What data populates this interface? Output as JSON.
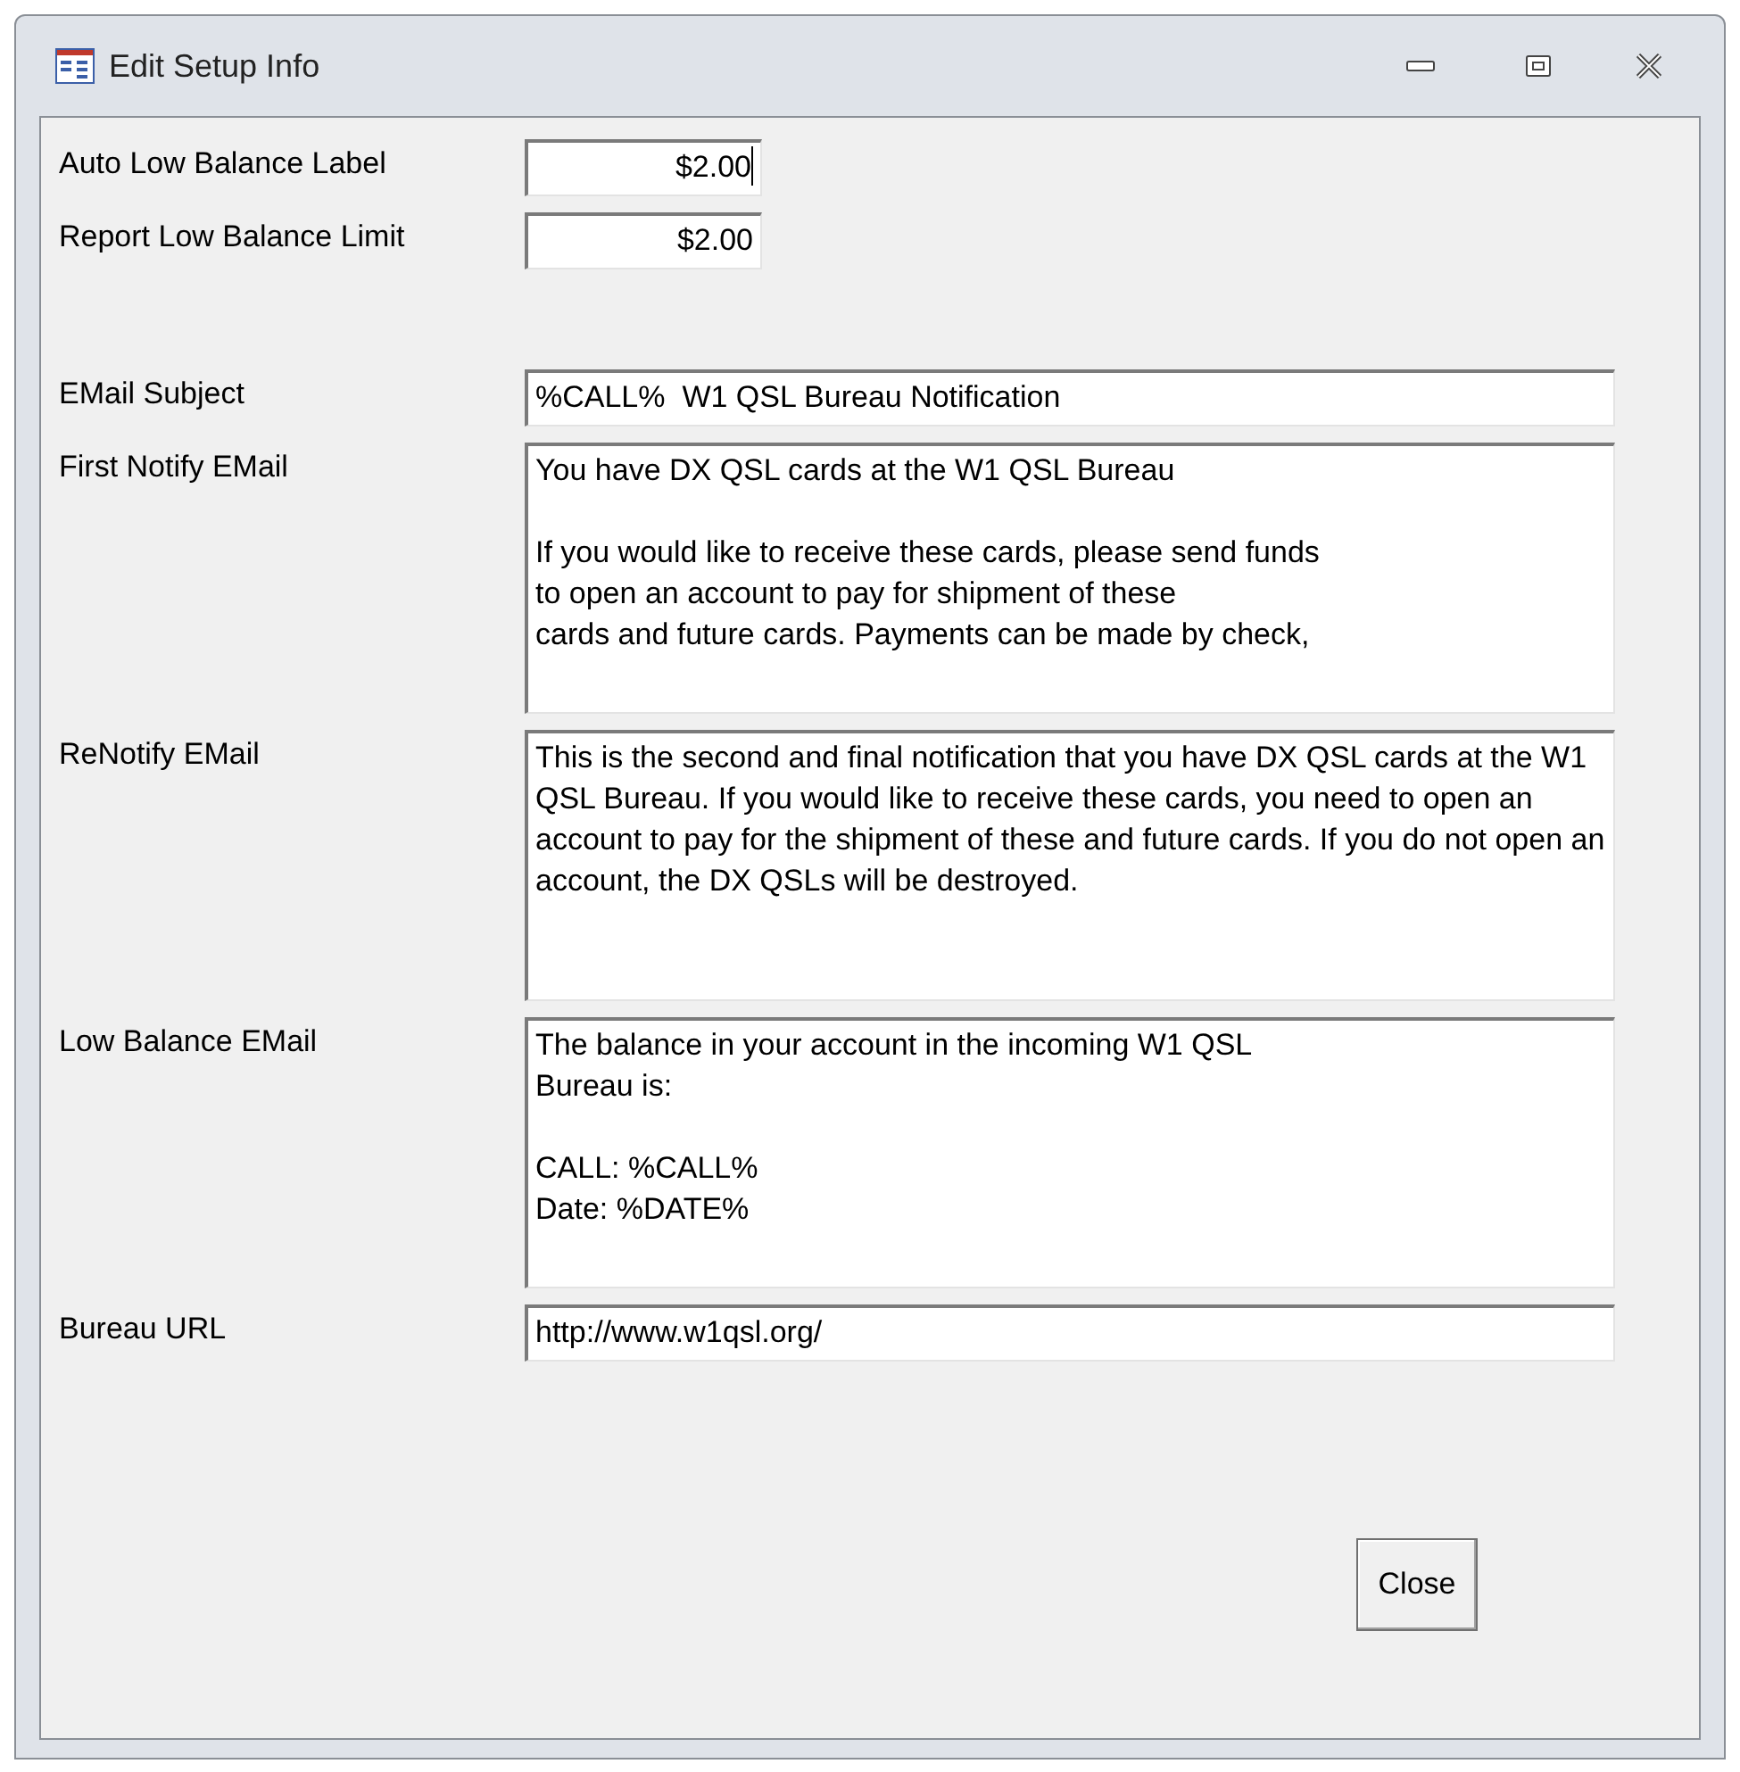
{
  "window": {
    "title": "Edit Setup Info"
  },
  "fields": [
    {
      "kind": "amount",
      "label": "Auto Low Balance Label",
      "value": "$2.00",
      "focused": true
    },
    {
      "kind": "amount",
      "label": "Report Low Balance Limit",
      "value": "$2.00",
      "focused": false
    },
    {
      "kind": "spacer"
    },
    {
      "kind": "line",
      "label": "EMail Subject",
      "value": "%CALL%  W1 QSL Bureau Notification"
    },
    {
      "kind": "memo",
      "label": "First Notify EMail",
      "value": "You have DX QSL cards at the W1 QSL Bureau\n\nIf you would like to receive these cards, please send funds\nto open an account to pay for shipment of these\ncards and future cards. Payments can be made by check,"
    },
    {
      "kind": "memo",
      "label": "ReNotify EMail",
      "value": "This is the second and final notification that you have DX QSL cards at the W1 QSL Bureau. If you would like to receive these cards, you need to open an account to pay for the shipment of these and future cards. If you do not open an account, the DX QSLs will be destroyed."
    },
    {
      "kind": "memo",
      "label": "Low Balance EMail",
      "value": "The balance in your account in the incoming W1 QSL\nBureau is:\n\nCALL: %CALL%\nDate: %DATE%"
    },
    {
      "kind": "url",
      "label": "Bureau URL",
      "value": "http://www.w1qsl.org/"
    }
  ],
  "buttons": [
    {
      "label": "Close"
    }
  ]
}
